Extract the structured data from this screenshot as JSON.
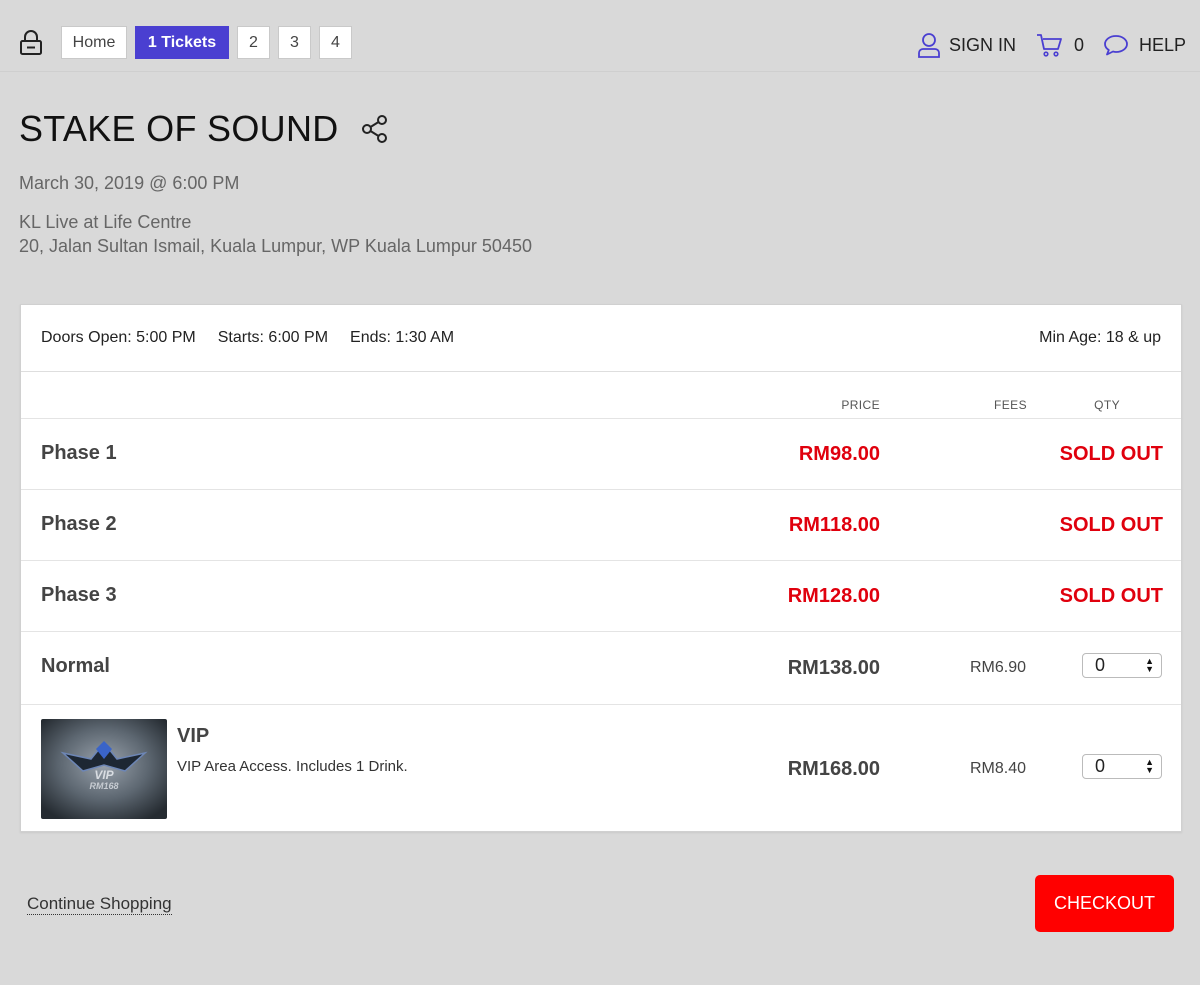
{
  "nav": {
    "breadcrumbs": [
      {
        "label": "Home"
      },
      {
        "label": "1 Tickets"
      },
      {
        "label": "2"
      },
      {
        "label": "3"
      },
      {
        "label": "4"
      }
    ],
    "sign_in": "SIGN IN",
    "cart_count": "0",
    "help": "HELP",
    "accent_color": "#4a3fd1"
  },
  "event": {
    "title": "STAKE OF SOUND",
    "date": "March 30, 2019 @ 6:00 PM",
    "venue_name": "KL Live at Life Centre",
    "venue_address": "20, Jalan Sultan Ismail, Kuala Lumpur, WP Kuala Lumpur 50450"
  },
  "info": {
    "doors": "Doors Open: 5:00 PM",
    "starts": "Starts: 6:00 PM",
    "ends": "Ends: 1:30 AM",
    "min_age": "Min Age: 18 & up"
  },
  "table": {
    "headers": {
      "price": "PRICE",
      "fees": "FEES",
      "qty": "QTY"
    },
    "rows": [
      {
        "name": "Phase 1",
        "price": "RM98.00",
        "status": "SOLD OUT"
      },
      {
        "name": "Phase 2",
        "price": "RM118.00",
        "status": "SOLD OUT"
      },
      {
        "name": "Phase 3",
        "price": "RM128.00",
        "status": "SOLD OUT"
      },
      {
        "name": "Normal",
        "price": "RM138.00",
        "fee": "RM6.90",
        "qty": "0"
      },
      {
        "name": "VIP",
        "description": "VIP Area Access. Includes 1 Drink.",
        "price": "RM168.00",
        "fee": "RM8.40",
        "qty": "0",
        "image_text": "VIP RM168"
      }
    ]
  },
  "footer": {
    "continue": "Continue Shopping",
    "checkout": "CHECKOUT",
    "checkout_color": "#ff0000"
  },
  "colors": {
    "sold_out": "#e0000d",
    "background": "#d9d9d9"
  }
}
